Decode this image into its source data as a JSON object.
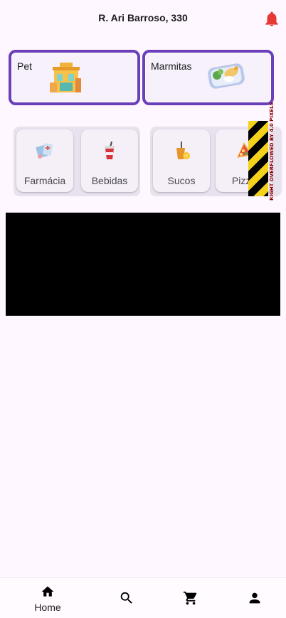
{
  "header": {
    "address": "R. Ari Barroso, 330",
    "bell_icon": "notification-bell-icon",
    "bell_color": "#e53935"
  },
  "featured": [
    {
      "label": "Pet",
      "icon": "pet-shop-building-icon"
    },
    {
      "label": "Marmitas",
      "icon": "lunchbox-meal-icon"
    }
  ],
  "categories": [
    {
      "label": "Farmácia",
      "icon": "pharmacy-icon"
    },
    {
      "label": "Bebidas",
      "icon": "drink-cup-icon"
    },
    {
      "label": "Sucos",
      "icon": "juice-icon"
    },
    {
      "label": "Pizza",
      "icon": "pizza-icon"
    }
  ],
  "debug": {
    "overflow_message": "RIGHT OVERFLOWED BY 4.0 PIXELS"
  },
  "nav": {
    "home_label": "Home",
    "items": [
      "home-icon",
      "search-icon",
      "cart-icon",
      "profile-icon"
    ]
  },
  "colors": {
    "accent": "#6a3fb9",
    "background": "#fef7ff"
  }
}
